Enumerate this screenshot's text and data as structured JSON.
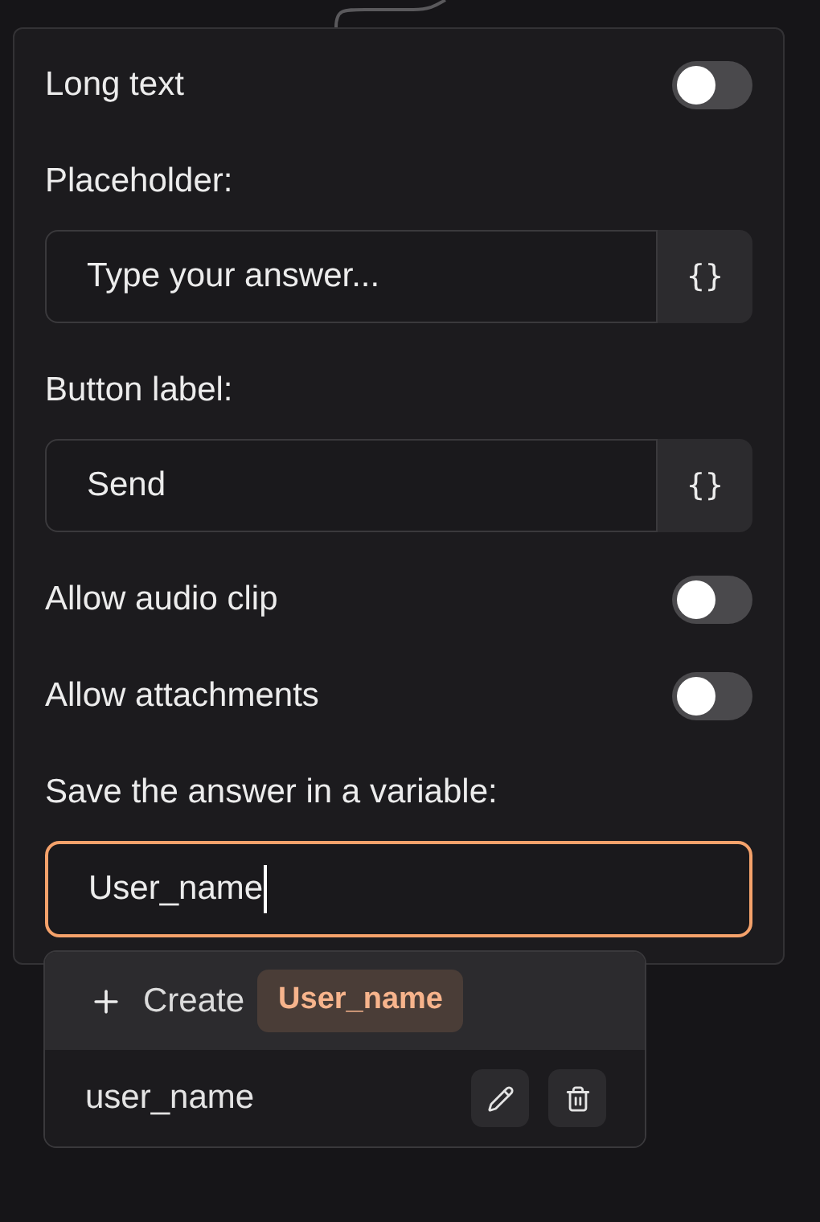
{
  "settings": [
    {
      "kind": "toggle",
      "label": "Long text",
      "on": false
    },
    {
      "kind": "text",
      "label": "Placeholder:",
      "value": "Type your answer...",
      "variable_button": "{}",
      "focused": false
    },
    {
      "kind": "text",
      "label": "Button label:",
      "value": "Send",
      "variable_button": "{}",
      "focused": false
    },
    {
      "kind": "toggle",
      "label": "Allow audio clip",
      "on": false
    },
    {
      "kind": "toggle",
      "label": "Allow attachments",
      "on": false
    },
    {
      "kind": "variable",
      "label": "Save the answer in a variable:",
      "value": "User_name",
      "focused": true
    }
  ],
  "dropdown": {
    "options": [
      {
        "kind": "create",
        "action": "Create",
        "chip": "User_name",
        "selected": true
      },
      {
        "kind": "variable",
        "label": "user_name",
        "selected": false
      }
    ]
  }
}
